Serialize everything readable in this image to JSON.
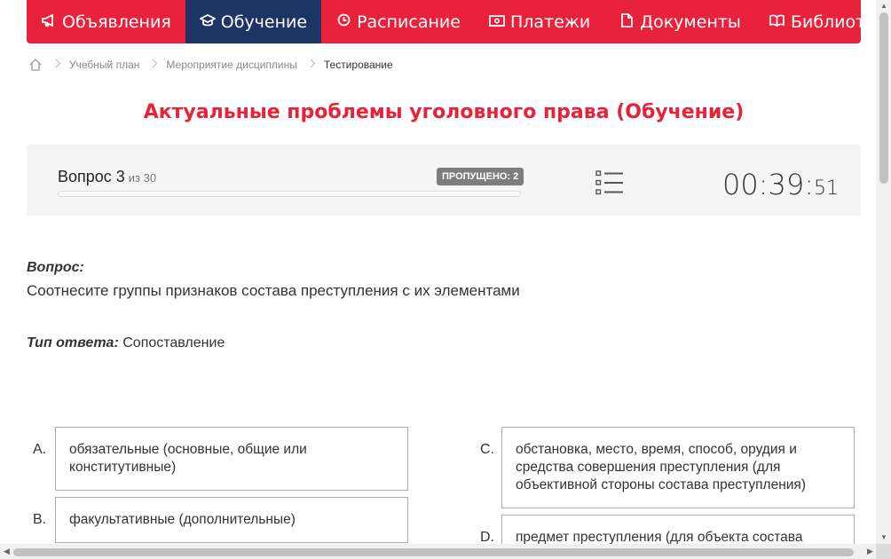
{
  "nav": {
    "items": [
      {
        "label": "Объявления",
        "icon": "megaphone-icon",
        "glyph": "✎"
      },
      {
        "label": "Обучение",
        "icon": "graduation-cap-icon",
        "glyph": "⌂"
      },
      {
        "label": "Расписание",
        "icon": "clock-icon",
        "glyph": "◷"
      },
      {
        "label": "Платежи",
        "icon": "money-icon",
        "glyph": "▭"
      },
      {
        "label": "Документы",
        "icon": "document-icon",
        "glyph": "▯"
      },
      {
        "label": "Библиотека",
        "icon": "book-icon",
        "glyph": "❐"
      }
    ],
    "active_index": 1,
    "accent_color": "#e8223a",
    "active_color": "#1e3465"
  },
  "breadcrumb": {
    "home_icon": "home-icon",
    "items": [
      "Учебный план",
      "Мероприятие дисциплины",
      "Тестирование"
    ]
  },
  "page": {
    "title": "Актуальные проблемы уголовного права (Обучение)"
  },
  "question_panel": {
    "question_label": "Вопрос 3",
    "of_label": "из 30",
    "progress_fraction": 0.0,
    "skipped_label": "ПРОПУЩЕНО: 2",
    "list_icon": "question-list-icon",
    "timer_main": "00:39:",
    "timer_seconds": "51"
  },
  "question": {
    "label": "Вопрос:",
    "text": "Соотнесите группы признаков состава преступления с их элементами",
    "answer_type_label": "Тип ответа:",
    "answer_type_value": "Сопоставление"
  },
  "matching": {
    "left": [
      {
        "letter": "A.",
        "text": "обязательные (основные, общие или конститутивные)"
      },
      {
        "letter": "B.",
        "text": "факультативные (дополнительные)"
      }
    ],
    "right": [
      {
        "letter": "C.",
        "text": "обстановка, место, время, способ, орудия и средства совершения преступления (для объективной стороны состава преступления)"
      },
      {
        "letter": "D.",
        "text": "предмет преступления (для объекта состава"
      }
    ]
  }
}
